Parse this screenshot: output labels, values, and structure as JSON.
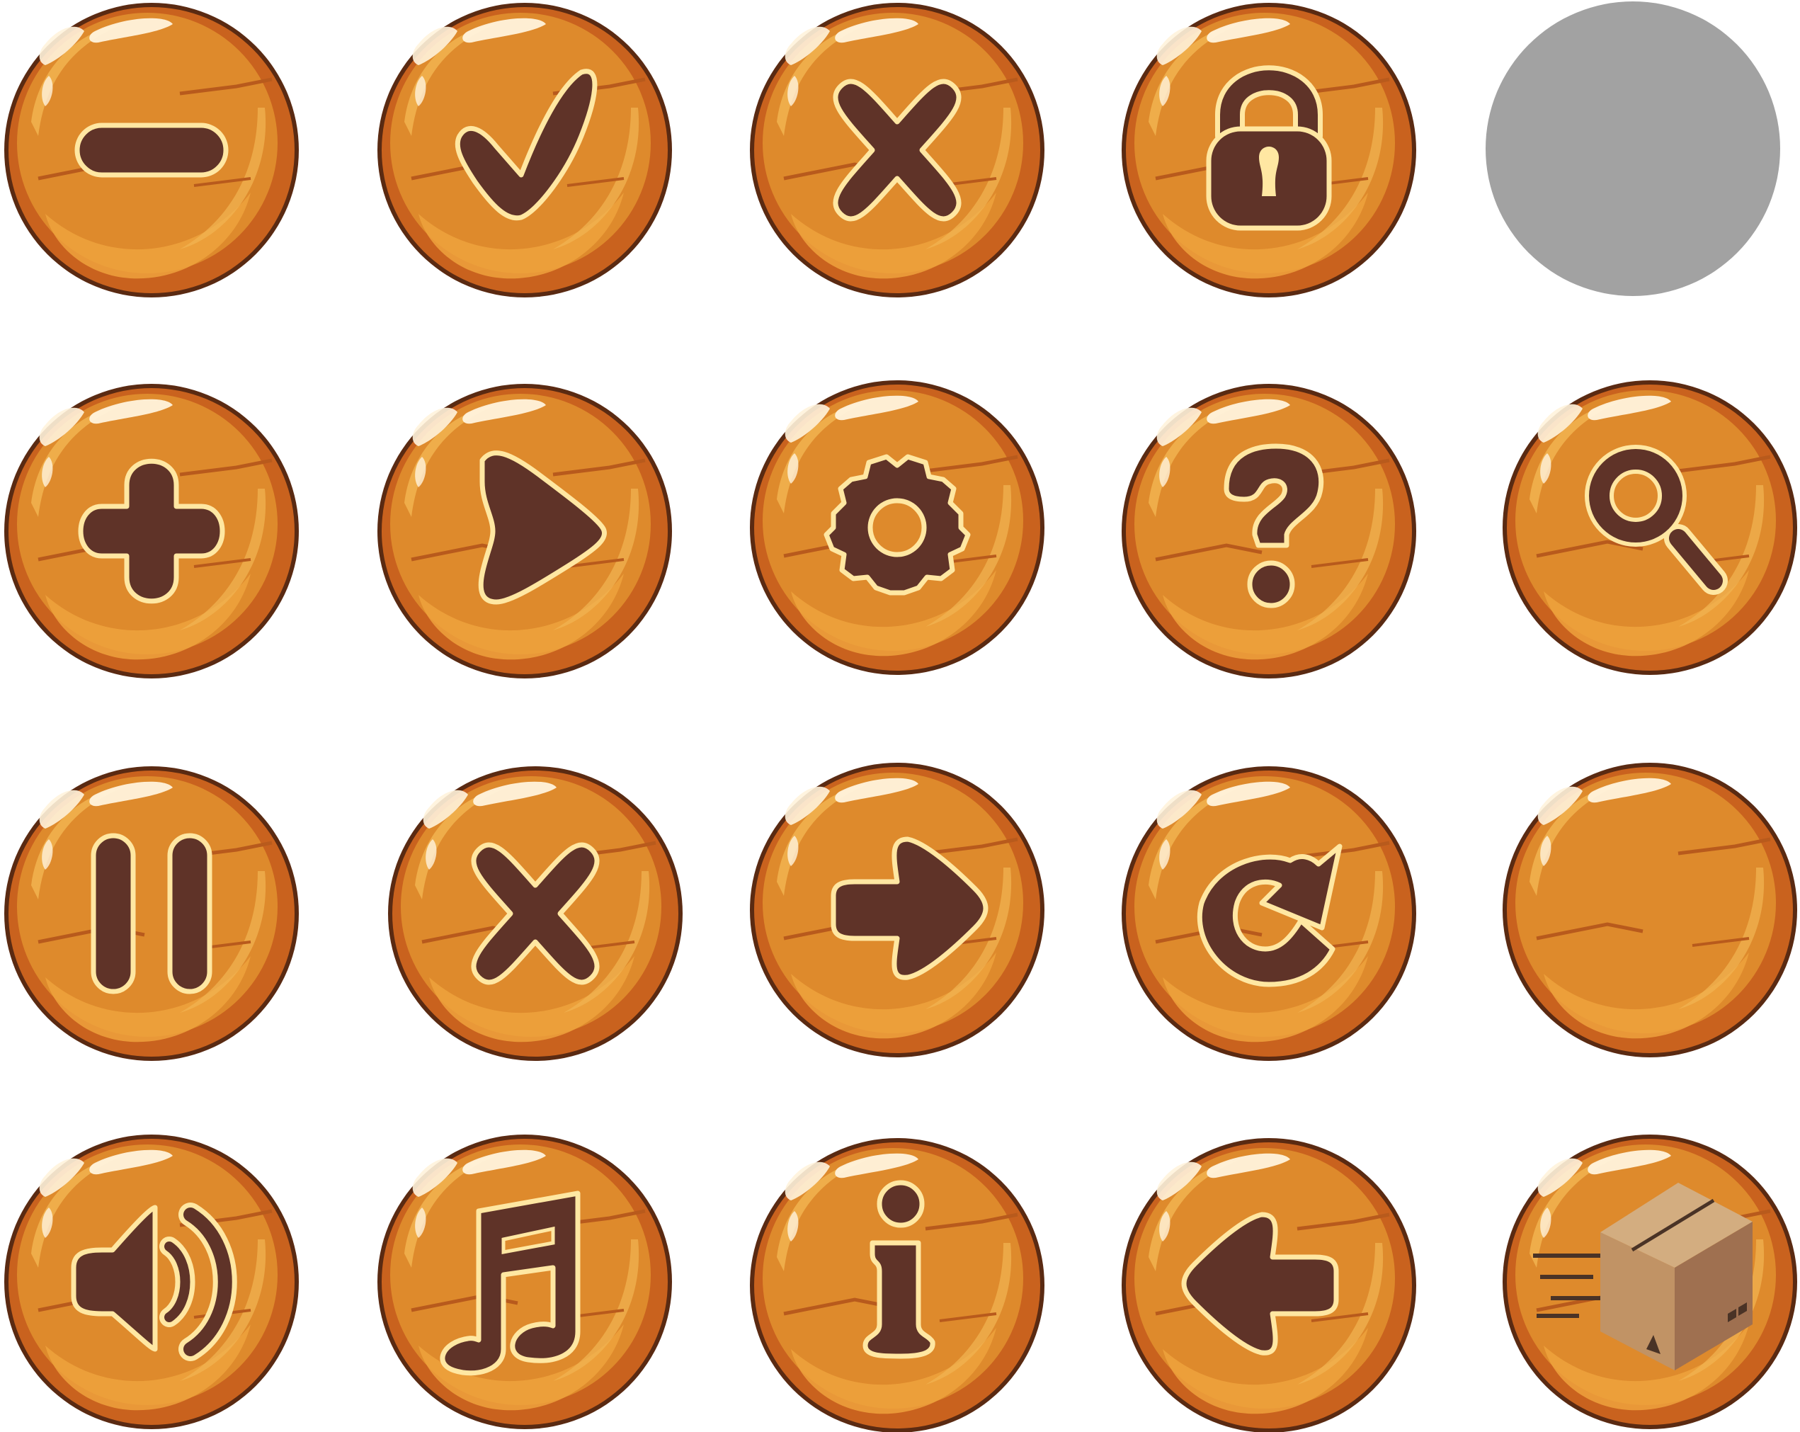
{
  "sheet": {
    "title": "",
    "buttons": [
      {
        "id": "minus",
        "name": "minus-button",
        "icon": "minus-icon",
        "interactable": true
      },
      {
        "id": "check",
        "name": "check-button",
        "icon": "checkmark-icon",
        "interactable": true
      },
      {
        "id": "close-wide",
        "name": "close-button",
        "icon": "x-icon",
        "interactable": true
      },
      {
        "id": "lock",
        "name": "lock-button",
        "icon": "padlock-icon",
        "interactable": true
      },
      {
        "id": "placeholder",
        "name": "empty-slot-placeholder",
        "icon": "gray-circle",
        "interactable": false
      },
      {
        "id": "plus",
        "name": "plus-button",
        "icon": "plus-icon",
        "interactable": true
      },
      {
        "id": "play",
        "name": "play-button",
        "icon": "play-icon",
        "interactable": true
      },
      {
        "id": "settings",
        "name": "settings-button",
        "icon": "gear-icon",
        "interactable": true
      },
      {
        "id": "help",
        "name": "help-button",
        "icon": "question-mark-icon",
        "interactable": true
      },
      {
        "id": "search",
        "name": "search-button",
        "icon": "magnifier-icon",
        "interactable": true
      },
      {
        "id": "pause",
        "name": "pause-button",
        "icon": "pause-icon",
        "interactable": true
      },
      {
        "id": "close",
        "name": "cancel-button",
        "icon": "x-icon",
        "interactable": true
      },
      {
        "id": "next",
        "name": "next-arrow-button",
        "icon": "arrow-right-icon",
        "interactable": true
      },
      {
        "id": "restart",
        "name": "restart-button",
        "icon": "refresh-icon",
        "interactable": true
      },
      {
        "id": "blank",
        "name": "blank-button",
        "icon": "none",
        "interactable": true
      },
      {
        "id": "sound",
        "name": "sound-button",
        "icon": "speaker-icon",
        "interactable": true
      },
      {
        "id": "music",
        "name": "music-button",
        "icon": "music-note-icon",
        "interactable": true
      },
      {
        "id": "info",
        "name": "info-button",
        "icon": "info-icon",
        "interactable": true
      },
      {
        "id": "back",
        "name": "back-arrow-button",
        "icon": "arrow-left-icon",
        "interactable": true
      },
      {
        "id": "delivery",
        "name": "delivery-box-button",
        "icon": "shipping-box-icon",
        "interactable": true
      }
    ]
  },
  "colors": {
    "outline": "#5a2a12",
    "rim": "#c9621e",
    "face": "#de8a2c",
    "face_light": "#eea23d",
    "streak": "#f2b552",
    "glyph": "#5f3328",
    "glyph_stroke": "#ffe7a2",
    "shine": "#fff3dc",
    "placeholder": "#a2a2a2",
    "box_top": "#d3ad80",
    "box_left": "#c19365",
    "box_right": "#9f7050",
    "box_tape": "#4a3326"
  }
}
